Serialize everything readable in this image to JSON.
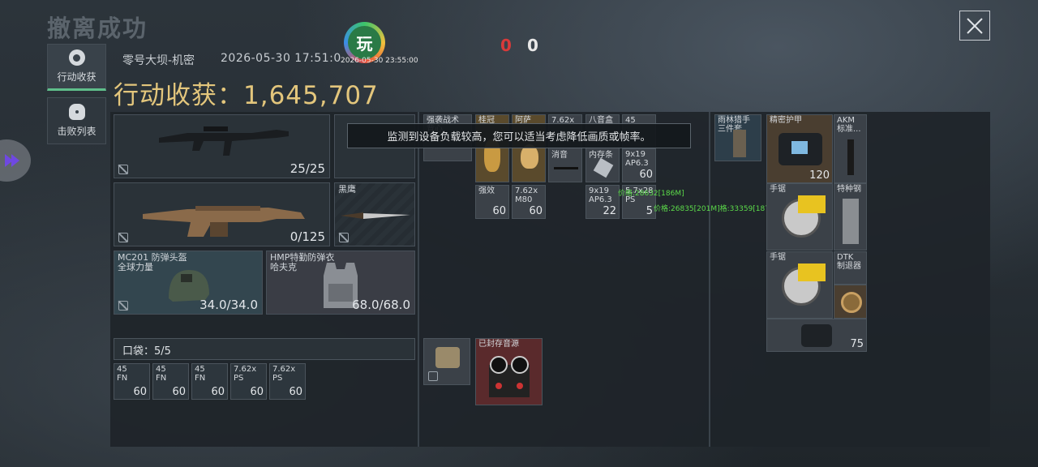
{
  "header": {
    "title": "撤离成功",
    "score_red": "0",
    "score_white": "0",
    "badge_text": "玩",
    "map": "零号大坝-机密",
    "time": "2026-05-30 17:51:0",
    "time_small": "2026-05-30 23:55:00",
    "harvest_label": "行动收获：",
    "harvest_value": "1,645,707"
  },
  "tabs": [
    {
      "label": "行动收获",
      "active": true
    },
    {
      "label": "击败列表",
      "active": false
    }
  ],
  "notice": "监测到设备负载较高，您可以适当考虑降低画质或帧率。",
  "debug_lines": [
    "价格:28632[186M]",
    "价格:26835[201M]格:33359[187M]"
  ],
  "loadout": {
    "primary_ammo": "25/25",
    "secondary_ammo": "0/125",
    "melee_label": "黑鹰",
    "helmet": {
      "label": "MC201 防弹头盔\n全球力量",
      "durability": "34.0/34.0"
    },
    "vest": {
      "label": "HMP特勤防弹衣\n哈夫克",
      "durability": "68.0/68.0"
    }
  },
  "pocket": {
    "label": "口袋：",
    "count": "5/5"
  },
  "pocket_items": [
    {
      "t": "45\nFN",
      "v": "60"
    },
    {
      "t": "45\nFN",
      "v": "60"
    },
    {
      "t": "45\nFN",
      "v": "60"
    },
    {
      "t": "7.62x\nPS",
      "v": "60"
    },
    {
      "t": "7.62x\nPS",
      "v": "60"
    }
  ],
  "backpack_items": [
    {
      "t": "强袭战术\n背心",
      "v": ""
    },
    {
      "t": "桂冠",
      "v": ""
    },
    {
      "t": "阿萨",
      "v": ""
    },
    {
      "t": "7.62x",
      "v": ""
    },
    {
      "t": "八音盒",
      "v": ""
    },
    {
      "t": "45",
      "v": ""
    },
    {
      "t": "消音",
      "v": ""
    },
    {
      "t": "内存条",
      "v": ""
    },
    {
      "t": "9x19\nAP6.3",
      "v": "60"
    },
    {
      "t": "强效",
      "v": "60"
    },
    {
      "t": "7.62x\nM80",
      "v": "60"
    },
    {
      "t": "9x19\nAP6.3",
      "v": "22"
    },
    {
      "t": "5.7x28\nPS",
      "v": "5"
    }
  ],
  "container_label": "已封存音源",
  "rig": {
    "rain_label": "雨林猎手\n三件套",
    "armor_label": "精密护甲",
    "armor_value": "120",
    "akm_label": "AKM\n标准...",
    "saw1_label": "手锯",
    "steel_label": "特种钢",
    "saw2_label": "手锯",
    "dtk_label": "DTK\n制退器",
    "bag_value": "75"
  }
}
